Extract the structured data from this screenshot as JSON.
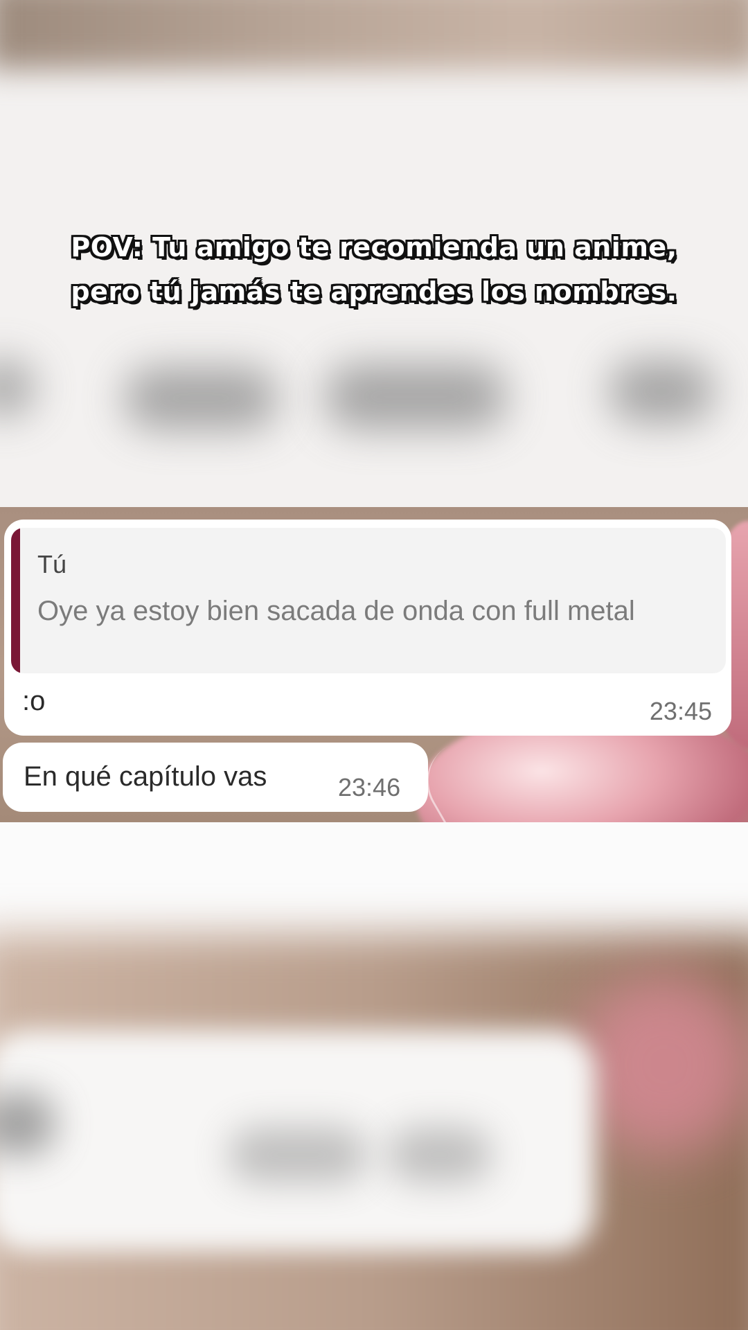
{
  "caption": {
    "line1": "POV: Tu amigo te recomienda un anime,",
    "line2": "pero tú jamás te aprendes los nombres."
  },
  "chat": {
    "messages": [
      {
        "quote": {
          "author": "Tú",
          "text": "Oye ya estoy bien sacada de onda con full metal"
        },
        "text": ":o",
        "time": "23:45"
      },
      {
        "text": "En qué capítulo vas",
        "time": "23:46"
      }
    ]
  },
  "colors": {
    "quote_bar": "#7a1736",
    "bubble": "#ffffff",
    "quote_background": "#f3f3f3"
  }
}
